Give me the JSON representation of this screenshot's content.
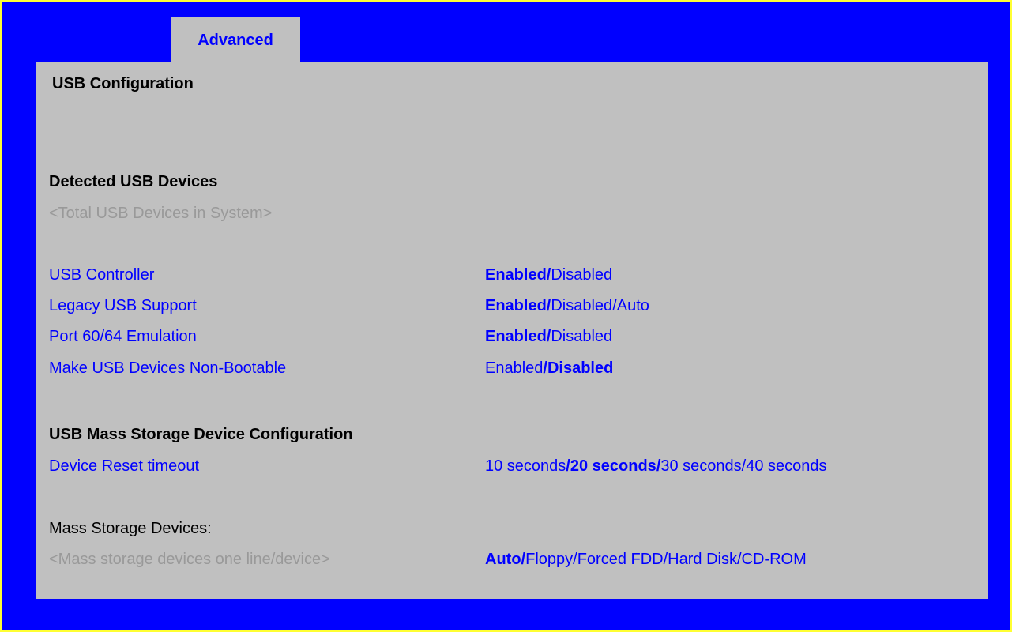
{
  "tab": {
    "label": "Advanced"
  },
  "page": {
    "title": "USB Configuration"
  },
  "sections": {
    "detected_header": "Detected USB Devices",
    "total_devices_placeholder": "<Total USB Devices in System>",
    "mass_storage_header": "USB Mass Storage Device Configuration",
    "mass_storage_devices_label": "Mass Storage Devices:",
    "mass_storage_placeholder": "<Mass storage devices one line/device>"
  },
  "settings": [
    {
      "label": "USB Controller",
      "options": [
        {
          "text": "Enabled",
          "selected": true
        },
        {
          "text": "Disabled",
          "selected": false
        }
      ]
    },
    {
      "label": "Legacy USB Support",
      "options": [
        {
          "text": "Enabled",
          "selected": true
        },
        {
          "text": "Disabled",
          "selected": false
        },
        {
          "text": "Auto",
          "selected": false
        }
      ]
    },
    {
      "label": "Port 60/64 Emulation",
      "options": [
        {
          "text": "Enabled",
          "selected": true
        },
        {
          "text": "Disabled",
          "selected": false
        }
      ]
    },
    {
      "label": "Make USB Devices Non-Bootable",
      "options": [
        {
          "text": "Enabled",
          "selected": false
        },
        {
          "text": "Disabled",
          "selected": true
        }
      ]
    },
    {
      "label": "Device Reset timeout",
      "options": [
        {
          "text": "10 seconds",
          "selected": false
        },
        {
          "text": "20 seconds",
          "selected": true
        },
        {
          "text": "30 seconds",
          "selected": false
        },
        {
          "text": "40 seconds",
          "selected": false
        }
      ]
    },
    {
      "label": "",
      "options": [
        {
          "text": "Auto",
          "selected": true
        },
        {
          "text": "Floppy",
          "selected": false
        },
        {
          "text": "Forced FDD",
          "selected": false
        },
        {
          "text": "Hard Disk",
          "selected": false
        },
        {
          "text": "CD-ROM",
          "selected": false
        }
      ]
    }
  ],
  "colors": {
    "outer_border": "#ffff33",
    "frame": "#0000ff",
    "panel": "#c0c0c0",
    "label": "#0000ff",
    "muted": "#999999"
  }
}
